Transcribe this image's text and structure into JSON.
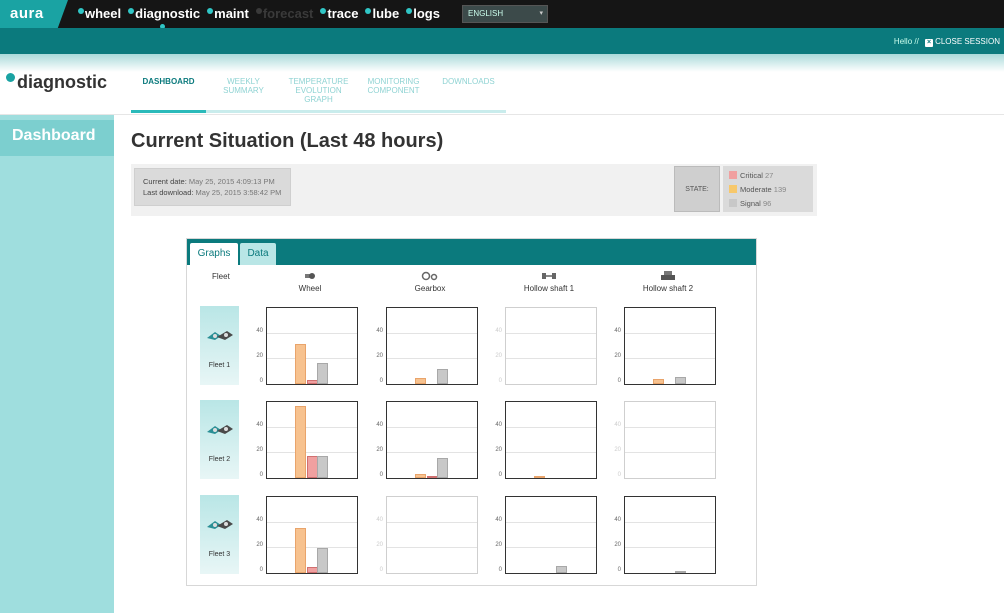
{
  "app": {
    "logo": "aura",
    "section": "diagnostic"
  },
  "nav": {
    "items": [
      {
        "label": "wheel",
        "state": "normal"
      },
      {
        "label": "diagnostic",
        "state": "active"
      },
      {
        "label": "maint",
        "state": "normal"
      },
      {
        "label": "forecast",
        "state": "disabled"
      },
      {
        "label": "trace",
        "state": "normal"
      },
      {
        "label": "lube",
        "state": "normal"
      },
      {
        "label": "logs",
        "state": "normal"
      }
    ],
    "language": "ENGLISH"
  },
  "session": {
    "greeting": "Hello",
    "separator": "//",
    "close_label": "CLOSE SESSION"
  },
  "subtabs": [
    {
      "label": "DASHBOARD",
      "active": true
    },
    {
      "label": "WEEKLY SUMMARY",
      "active": false
    },
    {
      "label": "TEMPERATURE EVOLUTION GRAPH",
      "active": false
    },
    {
      "label": "MONITORING COMPONENT",
      "active": false
    },
    {
      "label": "DOWNLOADS",
      "active": false
    }
  ],
  "sidebar": {
    "items": [
      {
        "label": "Dashboard"
      }
    ]
  },
  "main": {
    "title": "Current Situation (Last 48 hours)",
    "current_date_label": "Current date:",
    "current_date": "May 25, 2015 4:09:13 PM",
    "last_download_label": "Last download:",
    "last_download": "May 25, 2015 3:58:42 PM",
    "state_label": "STATE:",
    "legend": [
      {
        "label": "Critical",
        "count": "27",
        "color": "#f0a0a0"
      },
      {
        "label": "Moderate",
        "count": "139",
        "color": "#f7c86b"
      },
      {
        "label": "Signal",
        "count": "96",
        "color": "#c8c8c8"
      }
    ]
  },
  "panel": {
    "tabs": [
      {
        "label": "Graphs",
        "active": true
      },
      {
        "label": "Data",
        "active": false
      }
    ],
    "fleet_header": "Fleet",
    "columns": [
      {
        "label": "Wheel",
        "icon": "wheel-icon"
      },
      {
        "label": "Gearbox",
        "icon": "gearbox-icon"
      },
      {
        "label": "Hollow shaft 1",
        "icon": "hollow-shaft-icon"
      },
      {
        "label": "Hollow shaft 2",
        "icon": "hollow-shaft-2-icon"
      }
    ],
    "fleets": [
      {
        "label": "Fleet 1"
      },
      {
        "label": "Fleet 2"
      },
      {
        "label": "Fleet 3"
      }
    ]
  },
  "chart_data": {
    "type": "bar",
    "series_names": [
      "Moderate",
      "Critical",
      "Signal"
    ],
    "series_colors": [
      "#f7c28f",
      "#f0a0a0",
      "#c8c8c8"
    ],
    "ylim": [
      0,
      60
    ],
    "yticks": [
      "0",
      "20",
      "40"
    ],
    "grid": [
      [
        {
          "active": true,
          "values": [
            32,
            3,
            17
          ]
        },
        {
          "active": true,
          "values": [
            5,
            0,
            12
          ]
        },
        {
          "active": false,
          "values": [
            0,
            0,
            0
          ]
        },
        {
          "active": true,
          "values": [
            4,
            0,
            6
          ]
        }
      ],
      [
        {
          "active": true,
          "values": [
            58,
            18,
            18
          ]
        },
        {
          "active": true,
          "values": [
            3,
            2,
            16
          ]
        },
        {
          "active": true,
          "values": [
            2,
            0,
            0
          ]
        },
        {
          "active": false,
          "values": [
            0,
            0,
            0
          ]
        }
      ],
      [
        {
          "active": true,
          "values": [
            36,
            5,
            20
          ]
        },
        {
          "active": false,
          "values": [
            0,
            0,
            0
          ]
        },
        {
          "active": true,
          "values": [
            0,
            0,
            6
          ]
        },
        {
          "active": true,
          "values": [
            0,
            0,
            2
          ]
        }
      ]
    ]
  }
}
